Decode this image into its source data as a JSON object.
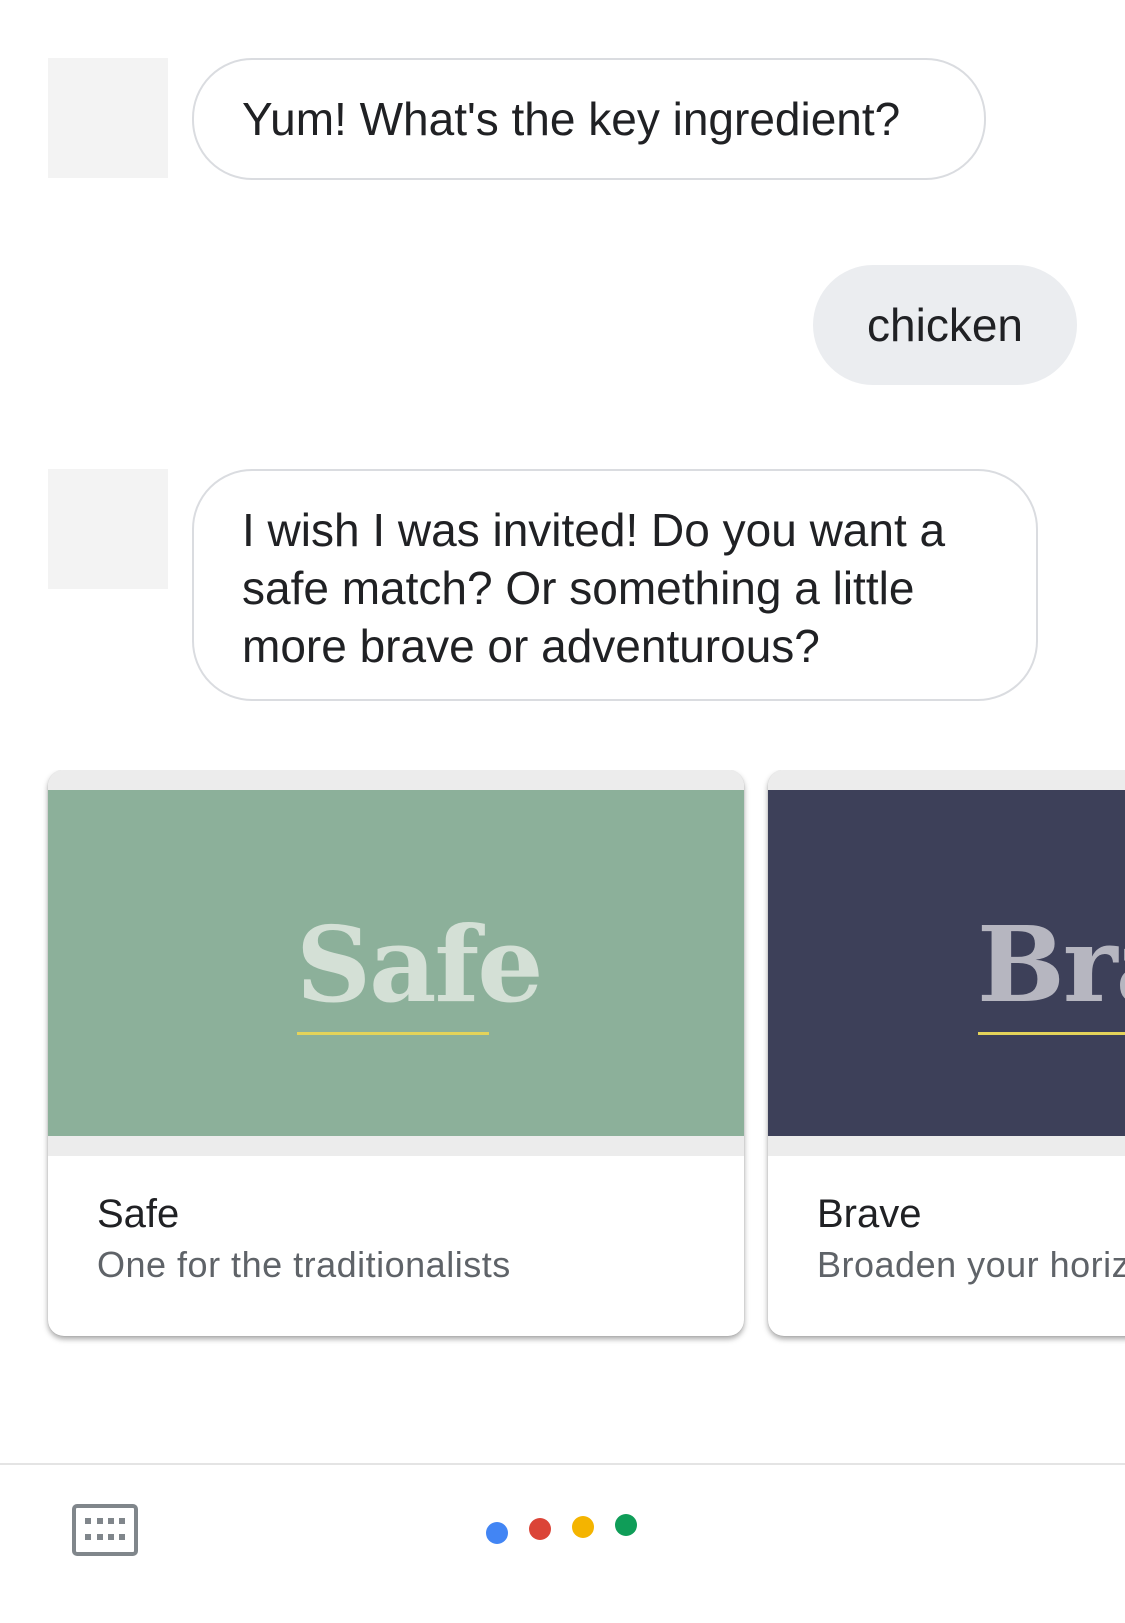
{
  "conversation": {
    "assistant_message_1": "Yum! What's the key ingredient?",
    "user_message_1": "chicken",
    "assistant_message_2": "I wish I was invited! Do you want a safe match? Or something a little more brave or adventurous?"
  },
  "cards": [
    {
      "image_text": "Safe",
      "image_color": "#8cb09a",
      "image_text_color": "#d4e0d6",
      "title": "Safe",
      "subtitle": "One for the traditionalists"
    },
    {
      "image_text": "Brave",
      "image_color": "#3d4059",
      "image_text_color": "#b6b6c0",
      "title": "Brave",
      "subtitle": "Broaden your horizons"
    }
  ],
  "colors": {
    "dot_blue": "#4285f4",
    "dot_red": "#db4437",
    "dot_yellow": "#f4b400",
    "dot_green": "#0f9d58",
    "underline": "#e4d35a"
  },
  "icons": {
    "keyboard": "keyboard-icon",
    "assistant": "google-assistant-dots-icon"
  }
}
